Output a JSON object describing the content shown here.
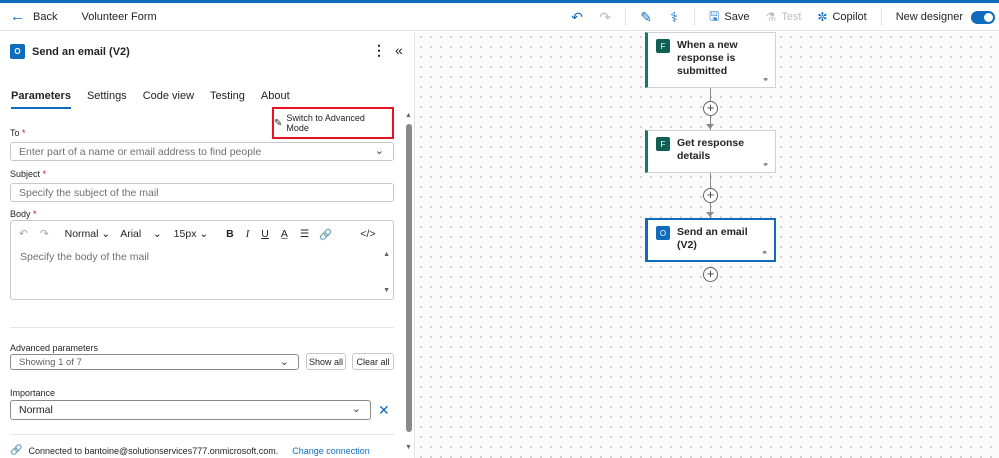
{
  "topbar": {
    "back_label": "Back",
    "flow_name": "Volunteer Form",
    "save_label": "Save",
    "test_label": "Test",
    "copilot_label": "Copilot",
    "new_designer_label": "New designer"
  },
  "panel": {
    "title": "Send an email (V2)",
    "tabs": [
      "Parameters",
      "Settings",
      "Code view",
      "Testing",
      "About"
    ],
    "advanced_mode_label": "Switch to Advanced Mode",
    "to": {
      "label": "To",
      "placeholder": "Enter part of a name or email address to find people"
    },
    "subject": {
      "label": "Subject",
      "placeholder": "Specify the subject of the mail"
    },
    "body": {
      "label": "Body",
      "format": "Normal",
      "font": "Arial",
      "size": "15px",
      "placeholder": "Specify the body of the mail"
    },
    "advanced_parameters": {
      "label": "Advanced parameters",
      "showing": "Showing 1 of 7",
      "show_all": "Show all",
      "clear_all": "Clear all"
    },
    "importance": {
      "label": "Importance",
      "value": "Normal"
    },
    "footer": {
      "connected_text": "Connected to bantoine@solutionservices777.onmicrosoft.com.",
      "change_connection": "Change connection"
    }
  },
  "canvas": {
    "cards": [
      {
        "title": "When a new response is submitted"
      },
      {
        "title": "Get response details"
      },
      {
        "title": "Send an email (V2)"
      }
    ]
  },
  "colors": {
    "accent": "#0f6cbd",
    "forms_green": "#0f7b6c",
    "highlight_red": "#e81123"
  }
}
